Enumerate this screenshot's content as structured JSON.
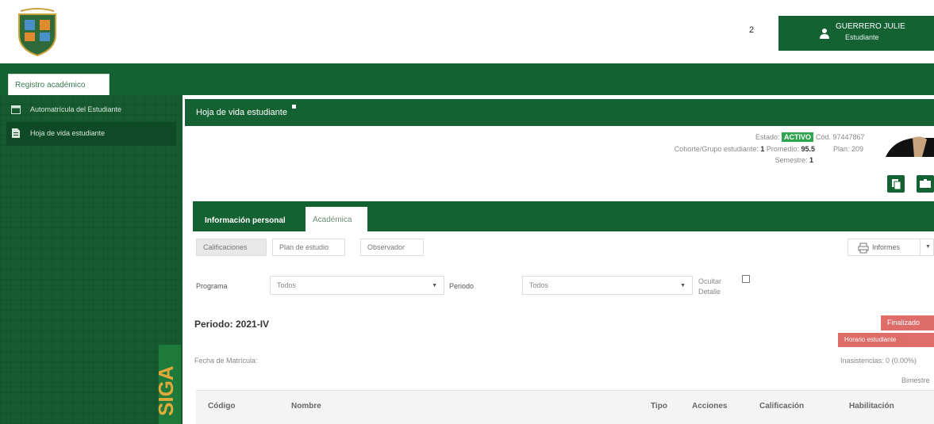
{
  "header": {
    "notifications_count": "2",
    "user_name": "GUERRERO JULIE",
    "user_role": "Estudiante"
  },
  "top_tab": {
    "label": "Registro académico"
  },
  "sidebar": {
    "items": [
      {
        "label": "Automatrícula del Estudiante",
        "icon": "calendar-icon"
      },
      {
        "label": "Hoja de vida estudiante",
        "icon": "document-icon"
      }
    ],
    "brand_text": "SIGA"
  },
  "main": {
    "title": "Hoja de vida estudiante",
    "estado_label": "Estado:",
    "estado_value": "ACTIVO",
    "cod": "Cód. 97447867",
    "plan": "Plan: 209",
    "cohorte_label": "Cohorte/Grupo estudiante:",
    "cohorte_value": "1",
    "promedio_label": "Promedio:",
    "promedio_value": "95.5",
    "semestre_label": "Semestre:",
    "semestre_value": "1",
    "tabs": [
      {
        "label": "Información personal"
      },
      {
        "label": "Académica"
      }
    ],
    "subtabs": [
      {
        "label": "Calificaciones"
      },
      {
        "label": "Plan de estudio"
      },
      {
        "label": "Observador"
      }
    ],
    "informes_label": "Informes",
    "filters": {
      "programa_label": "Programa",
      "programa_value": "Todos",
      "periodo_label": "Periodo",
      "periodo_value": "Todos",
      "ocultar_label_1": "Ocultar",
      "ocultar_label_2": "Detalle"
    },
    "periodo": {
      "title": "Periodo: 2021-IV",
      "status_button": "Finalizado",
      "horario_button": "Horario estudiante",
      "fecha_label": "Fecha de Matrícula:",
      "inasistencias": "Inasistencias: 0 (0.00%)",
      "bimestre": "Bimestre"
    },
    "table": {
      "columns": [
        "Código",
        "Nombre",
        "Tipo",
        "Acciones",
        "Calificación",
        "Habilitación"
      ]
    }
  },
  "colors": {
    "brand_green": "#146232",
    "sidebar_green": "#175a2f",
    "active_badge": "#2ea44f",
    "danger": "#d9534f"
  }
}
